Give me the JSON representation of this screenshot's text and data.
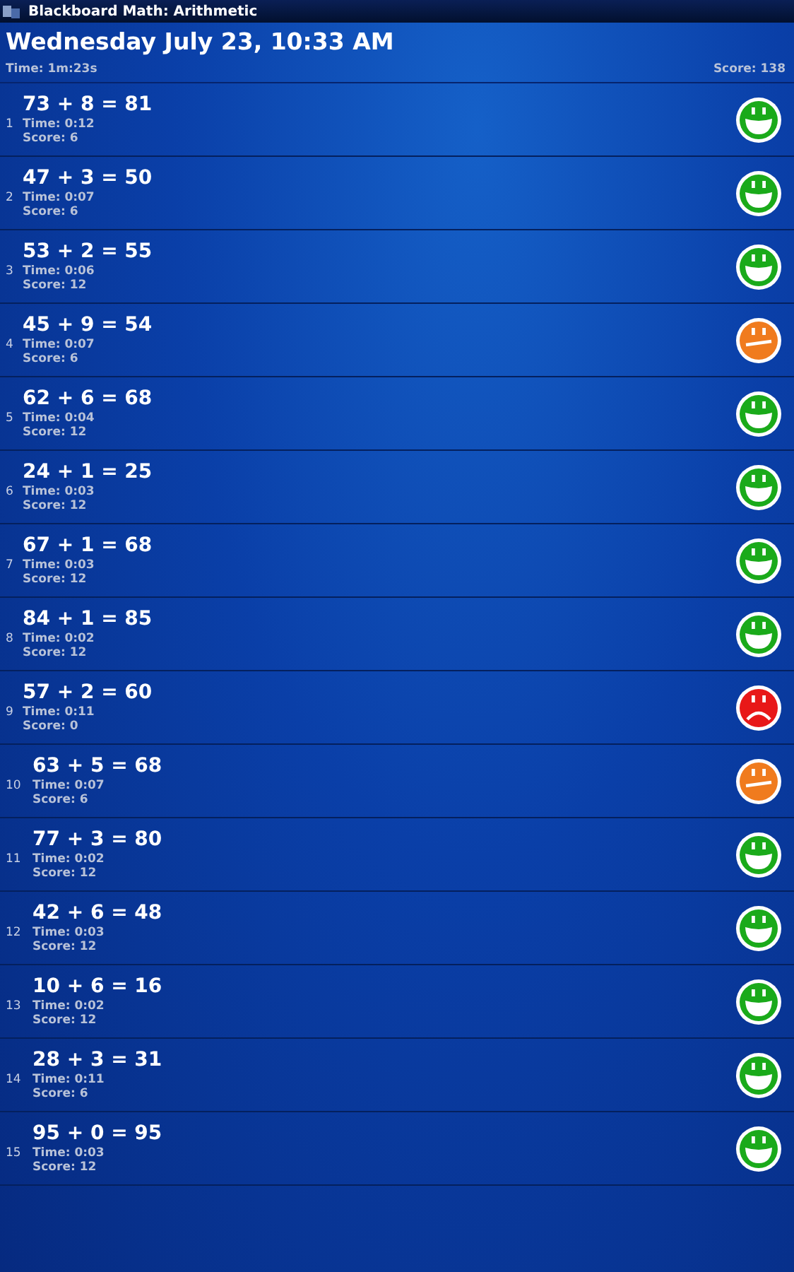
{
  "title_bar": {
    "app_title": "Blackboard Math: Arithmetic"
  },
  "header": {
    "date": "Wednesday July 23, 10:33 AM",
    "time": "Time: 1m:23s",
    "score": "Score: 138"
  },
  "problems": [
    {
      "number": "1",
      "equation": "73 + 8 = 81",
      "time": "Time: 0:12",
      "score": "Score: 6",
      "kind": "happy"
    },
    {
      "number": "2",
      "equation": "47 + 3 = 50",
      "time": "Time: 0:07",
      "score": "Score: 6",
      "kind": "happy"
    },
    {
      "number": "3",
      "equation": "53 + 2 = 55",
      "time": "Time: 0:06",
      "score": "Score: 12",
      "kind": "happy"
    },
    {
      "number": "4",
      "equation": "45 + 9 = 54",
      "time": "Time: 0:07",
      "score": "Score: 6",
      "kind": "neutral"
    },
    {
      "number": "5",
      "equation": "62 + 6 = 68",
      "time": "Time: 0:04",
      "score": "Score: 12",
      "kind": "happy"
    },
    {
      "number": "6",
      "equation": "24 + 1 = 25",
      "time": "Time: 0:03",
      "score": "Score: 12",
      "kind": "happy"
    },
    {
      "number": "7",
      "equation": "67 + 1 = 68",
      "time": "Time: 0:03",
      "score": "Score: 12",
      "kind": "happy"
    },
    {
      "number": "8",
      "equation": "84 + 1 = 85",
      "time": "Time: 0:02",
      "score": "Score: 12",
      "kind": "happy"
    },
    {
      "number": "9",
      "equation": "57 + 2 = 60",
      "time": "Time: 0:11",
      "score": "Score: 0",
      "kind": "sad"
    },
    {
      "number": "10",
      "equation": "63 + 5 = 68",
      "time": "Time: 0:07",
      "score": "Score: 6",
      "kind": "neutral"
    },
    {
      "number": "11",
      "equation": "77 + 3 = 80",
      "time": "Time: 0:02",
      "score": "Score: 12",
      "kind": "happy"
    },
    {
      "number": "12",
      "equation": "42 + 6 = 48",
      "time": "Time: 0:03",
      "score": "Score: 12",
      "kind": "happy"
    },
    {
      "number": "13",
      "equation": "10 + 6 = 16",
      "time": "Time: 0:02",
      "score": "Score: 12",
      "kind": "happy"
    },
    {
      "number": "14",
      "equation": "28 + 3 = 31",
      "time": "Time: 0:11",
      "score": "Score: 6",
      "kind": "happy"
    },
    {
      "number": "15",
      "equation": "95 + 0 = 95",
      "time": "Time: 0:03",
      "score": "Score: 12",
      "kind": "happy"
    }
  ]
}
